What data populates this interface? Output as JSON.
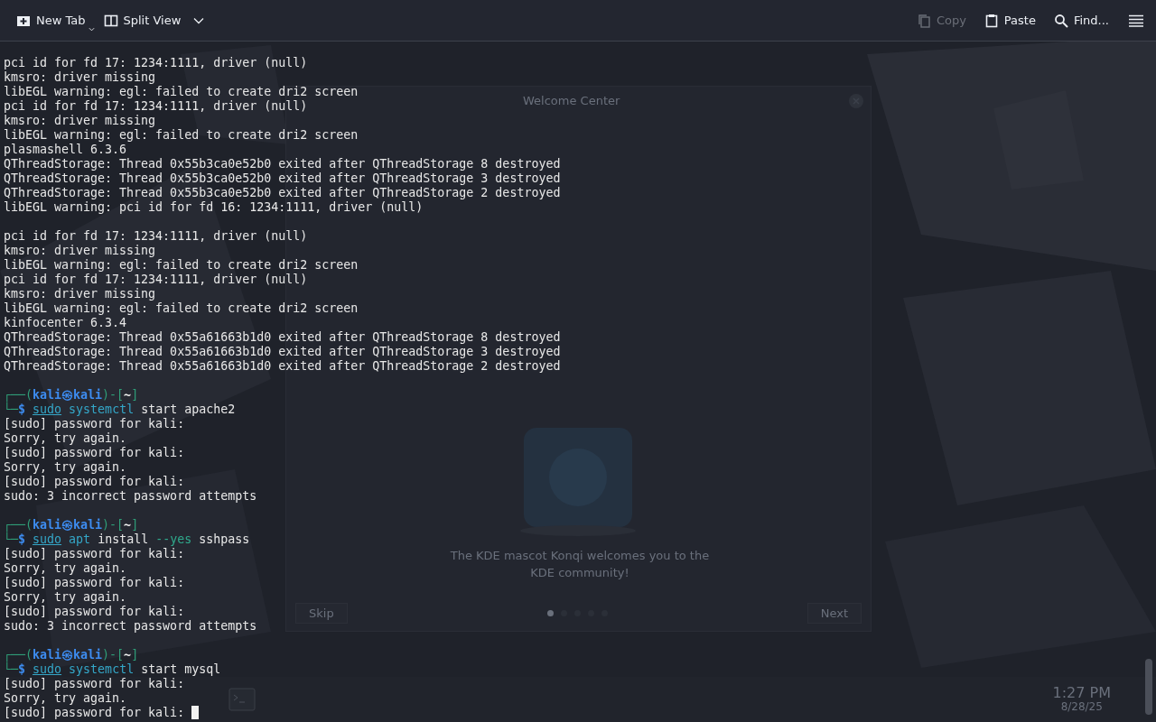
{
  "toolbar": {
    "left": [
      {
        "label": "New Tab",
        "has_menu": true
      },
      {
        "label": "Split View",
        "has_menu": true
      }
    ],
    "right": [
      {
        "label": "Copy",
        "disabled": true
      },
      {
        "label": "Paste",
        "disabled": false
      },
      {
        "label": "Find...",
        "disabled": false
      }
    ]
  },
  "background_window": {
    "title": "Welcome Center",
    "caption": "The KDE mascot Konqi welcomes you to the KDE community!",
    "skip": "Skip",
    "next": "Next",
    "pages": [
      {
        "selected": true
      },
      {
        "selected": false
      },
      {
        "selected": false
      },
      {
        "selected": false
      },
      {
        "selected": false
      }
    ]
  },
  "taskbar": {
    "time": "1:27 PM",
    "date": "8/28/25"
  },
  "terminal": {
    "lines": [
      {
        "kind": "text",
        "text": "pci id for fd 17: 1234:1111, driver (null)"
      },
      {
        "kind": "text",
        "text": "kmsro: driver missing"
      },
      {
        "kind": "text",
        "text": "libEGL warning: egl: failed to create dri2 screen"
      },
      {
        "kind": "text",
        "text": "pci id for fd 17: 1234:1111, driver (null)"
      },
      {
        "kind": "text",
        "text": "kmsro: driver missing"
      },
      {
        "kind": "text",
        "text": "libEGL warning: egl: failed to create dri2 screen"
      },
      {
        "kind": "text",
        "text": "plasmashell 6.3.6"
      },
      {
        "kind": "text",
        "text": "QThreadStorage: Thread 0x55b3ca0e52b0 exited after QThreadStorage 8 destroyed"
      },
      {
        "kind": "text",
        "text": "QThreadStorage: Thread 0x55b3ca0e52b0 exited after QThreadStorage 3 destroyed"
      },
      {
        "kind": "text",
        "text": "QThreadStorage: Thread 0x55b3ca0e52b0 exited after QThreadStorage 2 destroyed"
      },
      {
        "kind": "text",
        "text": "libEGL warning: pci id for fd 16: 1234:1111, driver (null)"
      },
      {
        "kind": "blank"
      },
      {
        "kind": "text",
        "text": "pci id for fd 17: 1234:1111, driver (null)"
      },
      {
        "kind": "text",
        "text": "kmsro: driver missing"
      },
      {
        "kind": "text",
        "text": "libEGL warning: egl: failed to create dri2 screen"
      },
      {
        "kind": "text",
        "text": "pci id for fd 17: 1234:1111, driver (null)"
      },
      {
        "kind": "text",
        "text": "kmsro: driver missing"
      },
      {
        "kind": "text",
        "text": "libEGL warning: egl: failed to create dri2 screen"
      },
      {
        "kind": "text",
        "text": "kinfocenter 6.3.4"
      },
      {
        "kind": "text",
        "text": "QThreadStorage: Thread 0x55a61663b1d0 exited after QThreadStorage 8 destroyed"
      },
      {
        "kind": "text",
        "text": "QThreadStorage: Thread 0x55a61663b1d0 exited after QThreadStorage 3 destroyed"
      },
      {
        "kind": "text",
        "text": "QThreadStorage: Thread 0x55a61663b1d0 exited after QThreadStorage 2 destroyed"
      },
      {
        "kind": "blank"
      },
      {
        "kind": "prompt",
        "open": "┌──(",
        "user_host": "kali㉿kali",
        "mid": ")-[",
        "dir": "~",
        "close": "]"
      },
      {
        "kind": "command",
        "corner": "└─",
        "sign": "$",
        "tokens": [
          {
            "text": "sudo",
            "kind": "sudo"
          },
          {
            "text": "systemctl",
            "kind": "program"
          },
          {
            "text": "start",
            "kind": "arg"
          },
          {
            "text": "apache2",
            "kind": "arg"
          }
        ]
      },
      {
        "kind": "text",
        "text": "[sudo] password for kali:"
      },
      {
        "kind": "text",
        "text": "Sorry, try again."
      },
      {
        "kind": "text",
        "text": "[sudo] password for kali:"
      },
      {
        "kind": "text",
        "text": "Sorry, try again."
      },
      {
        "kind": "text",
        "text": "[sudo] password for kali:"
      },
      {
        "kind": "text",
        "text": "sudo: 3 incorrect password attempts"
      },
      {
        "kind": "blank"
      },
      {
        "kind": "prompt",
        "open": "┌──(",
        "user_host": "kali㉿kali",
        "mid": ")-[",
        "dir": "~",
        "close": "]"
      },
      {
        "kind": "command",
        "corner": "└─",
        "sign": "$",
        "tokens": [
          {
            "text": "sudo",
            "kind": "sudo"
          },
          {
            "text": "apt",
            "kind": "program"
          },
          {
            "text": "install",
            "kind": "arg"
          },
          {
            "text": "--yes",
            "kind": "option"
          },
          {
            "text": "sshpass",
            "kind": "arg"
          }
        ]
      },
      {
        "kind": "text",
        "text": "[sudo] password for kali:"
      },
      {
        "kind": "text",
        "text": "Sorry, try again."
      },
      {
        "kind": "text",
        "text": "[sudo] password for kali:"
      },
      {
        "kind": "text",
        "text": "Sorry, try again."
      },
      {
        "kind": "text",
        "text": "[sudo] password for kali:"
      },
      {
        "kind": "text",
        "text": "sudo: 3 incorrect password attempts"
      },
      {
        "kind": "blank"
      },
      {
        "kind": "prompt",
        "open": "┌──(",
        "user_host": "kali㉿kali",
        "mid": ")-[",
        "dir": "~",
        "close": "]"
      },
      {
        "kind": "command",
        "corner": "└─",
        "sign": "$",
        "tokens": [
          {
            "text": "sudo",
            "kind": "sudo"
          },
          {
            "text": "systemctl",
            "kind": "program"
          },
          {
            "text": "start",
            "kind": "arg"
          },
          {
            "text": "mysql",
            "kind": "arg"
          }
        ]
      },
      {
        "kind": "text",
        "text": "[sudo] password for kali:"
      },
      {
        "kind": "text",
        "text": "Sorry, try again."
      },
      {
        "kind": "input",
        "text": "[sudo] password for kali:",
        "cursor": true
      }
    ]
  }
}
